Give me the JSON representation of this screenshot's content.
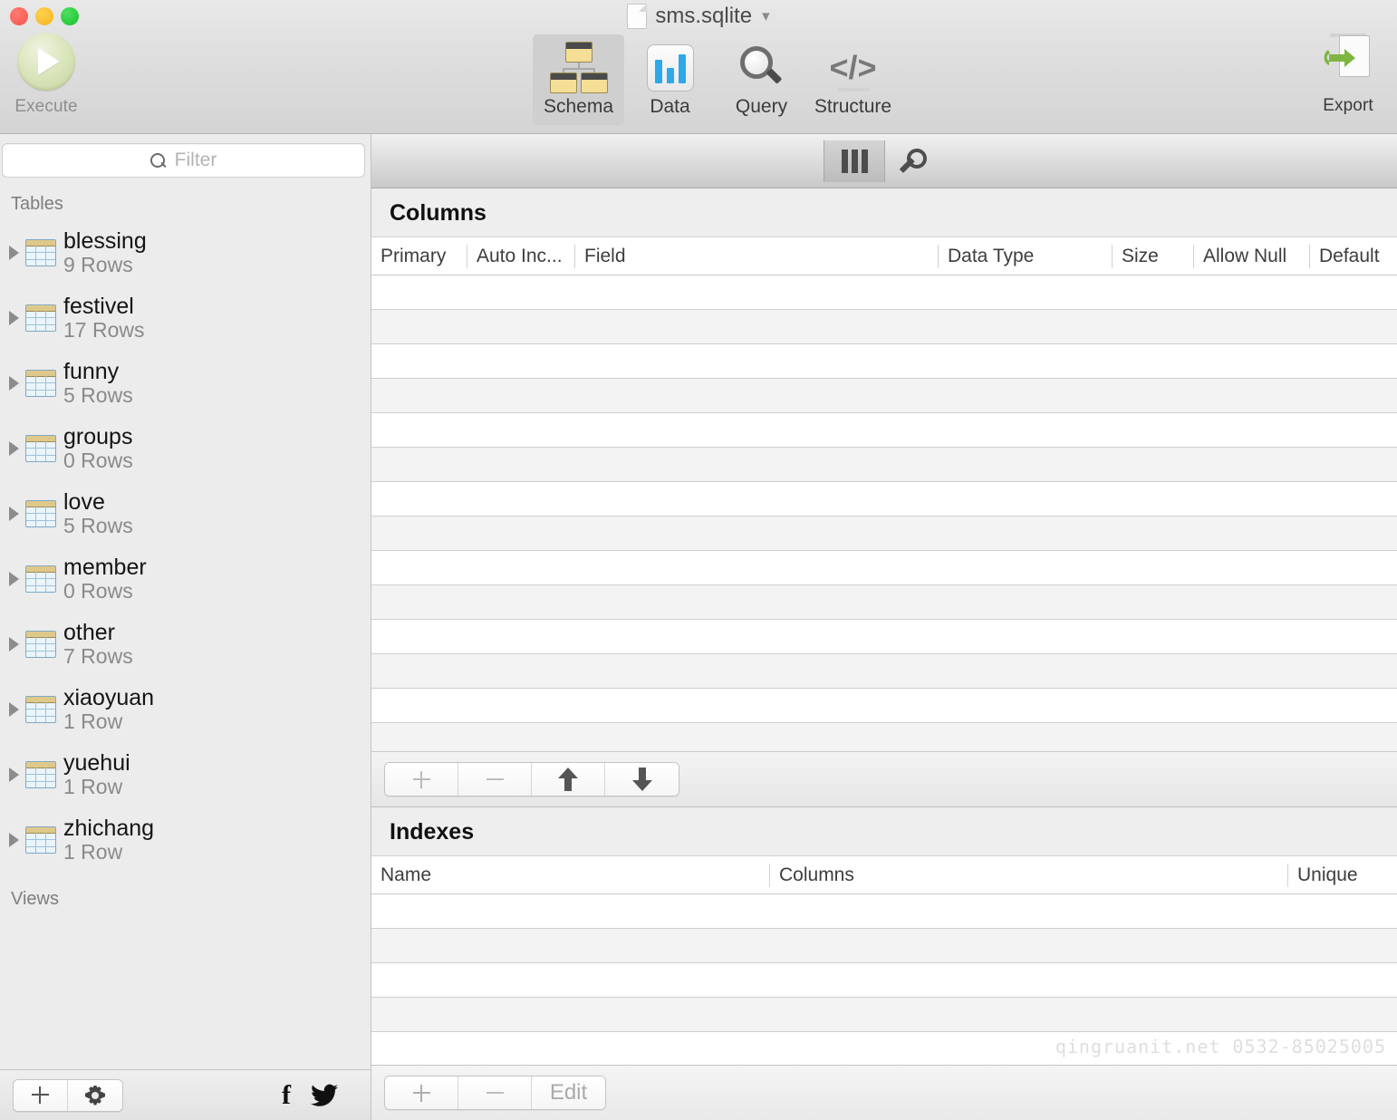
{
  "window": {
    "title": "sms.sqlite",
    "traffic_lights": [
      "close",
      "minimize",
      "zoom"
    ]
  },
  "toolbar": {
    "execute_label": "Execute",
    "export_label": "Export",
    "tabs": [
      {
        "id": "schema",
        "label": "Schema",
        "icon": "schema-icon",
        "selected": true
      },
      {
        "id": "data",
        "label": "Data",
        "icon": "bar-chart-icon",
        "selected": false
      },
      {
        "id": "query",
        "label": "Query",
        "icon": "magnifier-icon",
        "selected": false
      },
      {
        "id": "structure",
        "label": "Structure",
        "icon": "code-icon",
        "selected": false
      }
    ]
  },
  "sidebar": {
    "filter_placeholder": "Filter",
    "filter_value": "",
    "groups": [
      {
        "label": "Tables"
      },
      {
        "label": "Views"
      }
    ],
    "tables": [
      {
        "name": "blessing",
        "rows": "9 Rows"
      },
      {
        "name": "festivel",
        "rows": "17 Rows"
      },
      {
        "name": "funny",
        "rows": "5 Rows"
      },
      {
        "name": "groups",
        "rows": "0 Rows"
      },
      {
        "name": "love",
        "rows": "5 Rows"
      },
      {
        "name": "member",
        "rows": "0 Rows"
      },
      {
        "name": "other",
        "rows": "7 Rows"
      },
      {
        "name": "xiaoyuan",
        "rows": "1 Row"
      },
      {
        "name": "yuehui",
        "rows": "1 Row"
      },
      {
        "name": "zhichang",
        "rows": "1 Row"
      }
    ],
    "views": [],
    "footer": {
      "add_label": "+",
      "settings_icon": "gear-icon",
      "facebook_icon": "facebook-icon",
      "twitter_icon": "twitter-icon"
    }
  },
  "main": {
    "view_toggle": [
      {
        "id": "columns-view",
        "icon": "columns-icon",
        "active": true
      },
      {
        "id": "keys-view",
        "icon": "key-icon",
        "active": false
      }
    ],
    "columns_section": {
      "title": "Columns",
      "headers": [
        "Primary",
        "Auto Inc...",
        "Field",
        "Data Type",
        "Size",
        "Allow Null",
        "Default"
      ],
      "rows": [],
      "empty_row_count": 14,
      "actions": [
        {
          "id": "add-column",
          "label": "+",
          "icon": "plus-icon",
          "enabled": false
        },
        {
          "id": "remove-column",
          "label": "−",
          "icon": "minus-icon",
          "enabled": false
        },
        {
          "id": "move-column-up",
          "label": "",
          "icon": "arrow-up-icon",
          "enabled": true
        },
        {
          "id": "move-column-down",
          "label": "",
          "icon": "arrow-down-icon",
          "enabled": true
        }
      ]
    },
    "indexes_section": {
      "title": "Indexes",
      "headers": [
        "Name",
        "Columns",
        "Unique"
      ],
      "rows": [],
      "empty_row_count": 5,
      "actions": [
        {
          "id": "add-index",
          "label": "+",
          "icon": "plus-icon",
          "enabled": true
        },
        {
          "id": "remove-index",
          "label": "−",
          "icon": "minus-icon",
          "enabled": false
        },
        {
          "id": "edit-index",
          "label": "Edit",
          "icon": "",
          "enabled": false
        }
      ]
    },
    "watermark": "qingruanit.net  0532-85025005"
  },
  "colors": {
    "accent_blue": "#2fa8e8",
    "execute_green": "#c6d6a0",
    "export_green": "#7fb541",
    "selected_tab_bg": "#cfcfcf",
    "window_bg": "#ececec",
    "row_stripe": "#f3f3f3",
    "watermark": "#dedede"
  }
}
